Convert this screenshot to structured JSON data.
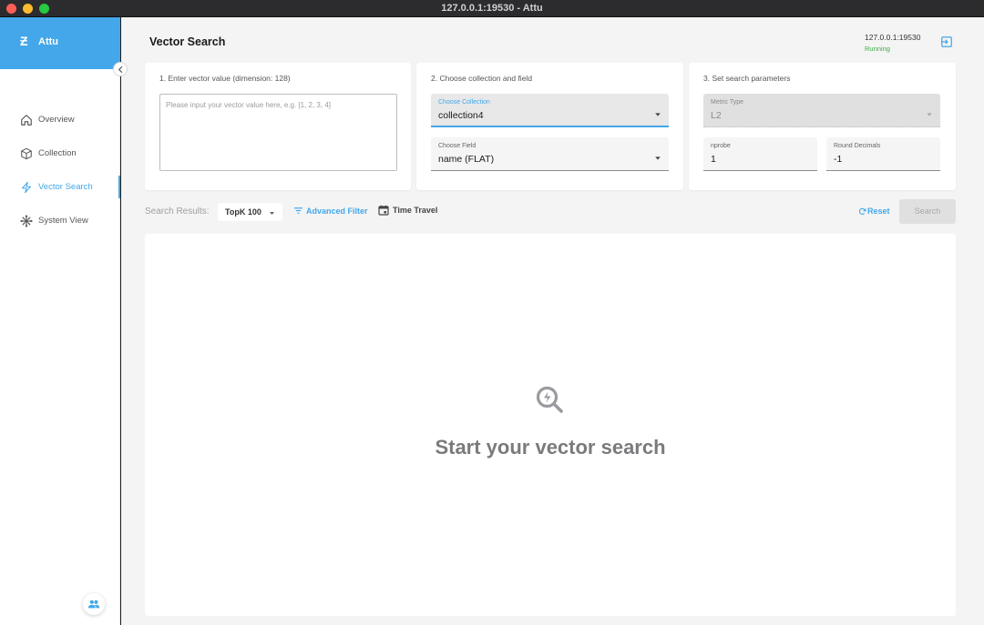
{
  "window": {
    "title": "127.0.0.1:19530 - Attu"
  },
  "sidebar": {
    "brand": {
      "logo_glyph": "Ƶ",
      "name": "Attu"
    },
    "items": [
      {
        "label": "Overview",
        "icon": "home-icon",
        "active": false
      },
      {
        "label": "Collection",
        "icon": "cube-icon",
        "active": false
      },
      {
        "label": "Vector Search",
        "icon": "lightning-icon",
        "active": true
      },
      {
        "label": "System View",
        "icon": "system-view-icon",
        "active": false
      }
    ],
    "user_icon": "users-icon"
  },
  "header": {
    "title": "Vector Search",
    "server_address": "127.0.0.1:19530",
    "server_status": "Running",
    "logout_icon": "logout-icon"
  },
  "step1": {
    "label": "1. Enter vector value (dimension: 128)",
    "placeholder": "Please input your vector value here, e.g. [1, 2, 3, 4]",
    "value": ""
  },
  "step2": {
    "label": "2. Choose collection and field",
    "collection": {
      "label": "Choose Collection",
      "value": "collection4"
    },
    "field": {
      "label": "Choose Field",
      "value": "name (FLAT)"
    }
  },
  "step3": {
    "label": "3. Set search parameters",
    "metric": {
      "label": "Metric Type",
      "value": "L2"
    },
    "nprobe": {
      "label": "nprobe",
      "value": "1"
    },
    "round": {
      "label": "Round Decimals",
      "value": "-1"
    }
  },
  "results_bar": {
    "label": "Search Results:",
    "topk": "TopK 100",
    "advanced_filter": "Advanced Filter",
    "time_travel": "Time Travel",
    "reset": "Reset",
    "search": "Search"
  },
  "empty_state": {
    "text": "Start your vector search",
    "icon": "search-empty-icon"
  },
  "colors": {
    "accent": "#43a7ea",
    "running": "#3dae48",
    "empty_text": "#7b7b7e"
  }
}
